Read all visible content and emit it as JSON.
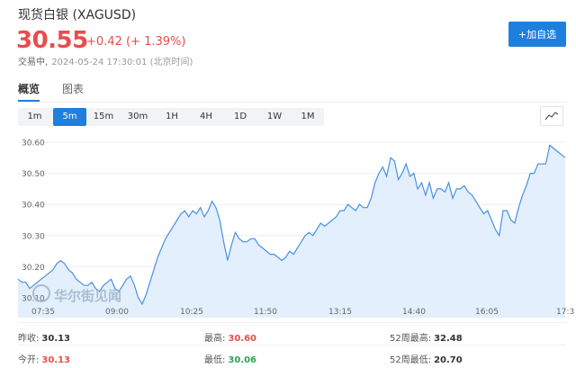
{
  "header": {
    "title": "现货白银 (XAGUSD)",
    "price": "30.55",
    "change": "+0.42 (+ 1.39%)",
    "status": "交易中,",
    "timestamp": "2024-05-24 17:30:01 (北京时间)",
    "watch_label": "+加自选"
  },
  "tabs": [
    {
      "label": "概览",
      "active": true
    },
    {
      "label": "图表",
      "active": false
    }
  ],
  "periods": [
    {
      "label": "1m",
      "active": false
    },
    {
      "label": "5m",
      "active": true
    },
    {
      "label": "15m",
      "active": false
    },
    {
      "label": "30m",
      "active": false
    },
    {
      "label": "1H",
      "active": false
    },
    {
      "label": "4H",
      "active": false
    },
    {
      "label": "1D",
      "active": false
    },
    {
      "label": "1W",
      "active": false
    },
    {
      "label": "1M",
      "active": false
    }
  ],
  "chart_data": {
    "type": "area",
    "title": "",
    "xlabel": "",
    "ylabel": "",
    "x_ticks": [
      "07:35",
      "09:00",
      "10:25",
      "11:50",
      "13:15",
      "14:40",
      "16:05",
      "17:3"
    ],
    "y_ticks": [
      "30.60",
      "30.50",
      "30.40",
      "30.30",
      "30.20",
      "30.10"
    ],
    "ylim": [
      30.1,
      30.6
    ],
    "x": [
      "07:35",
      "07:40",
      "07:45",
      "07:50",
      "07:55",
      "08:00",
      "08:05",
      "08:10",
      "08:15",
      "08:20",
      "08:25",
      "08:30",
      "08:35",
      "08:40",
      "08:45",
      "08:50",
      "08:55",
      "09:00",
      "09:05",
      "09:10",
      "09:15",
      "09:20",
      "09:25",
      "09:30",
      "09:35",
      "09:40",
      "09:45",
      "09:50",
      "09:55",
      "10:00",
      "10:05",
      "10:10",
      "10:15",
      "10:20",
      "10:25",
      "10:30",
      "10:35",
      "10:40",
      "10:45",
      "10:50",
      "10:55",
      "11:00",
      "11:05",
      "11:10",
      "11:15",
      "11:20",
      "11:25",
      "11:30",
      "11:35",
      "11:40",
      "11:45",
      "11:50",
      "11:55",
      "12:00",
      "12:05",
      "12:10",
      "12:15",
      "12:20",
      "12:25",
      "12:30",
      "12:35",
      "12:40",
      "12:45",
      "12:50",
      "12:55",
      "13:00",
      "13:05",
      "13:10",
      "13:15",
      "13:20",
      "13:25",
      "13:30",
      "13:35",
      "13:40",
      "13:45",
      "13:50",
      "13:55",
      "14:00",
      "14:05",
      "14:10",
      "14:15",
      "14:20",
      "14:25",
      "14:30",
      "14:35",
      "14:40",
      "14:45",
      "14:50",
      "14:55",
      "15:00",
      "15:05",
      "15:10",
      "15:15",
      "15:20",
      "15:25",
      "15:30",
      "15:35",
      "15:40",
      "15:45",
      "15:50",
      "15:55",
      "16:00",
      "16:05",
      "16:10",
      "16:15",
      "16:20",
      "16:25",
      "16:30",
      "16:35",
      "16:40",
      "16:45",
      "16:50",
      "16:55",
      "17:00",
      "17:05",
      "17:10",
      "17:15",
      "17:20",
      "17:25",
      "17:30"
    ],
    "values": [
      30.16,
      30.15,
      30.15,
      30.13,
      30.14,
      30.15,
      30.16,
      30.17,
      30.18,
      30.19,
      30.21,
      30.22,
      30.21,
      30.19,
      30.18,
      30.16,
      30.15,
      30.14,
      30.14,
      30.15,
      30.13,
      30.12,
      30.14,
      30.15,
      30.16,
      30.13,
      30.12,
      30.14,
      30.16,
      30.17,
      30.14,
      30.1,
      30.08,
      30.11,
      30.15,
      30.19,
      30.23,
      30.26,
      30.29,
      30.31,
      30.33,
      30.35,
      30.37,
      30.38,
      30.36,
      30.38,
      30.37,
      30.39,
      30.36,
      30.38,
      30.41,
      30.39,
      30.35,
      30.28,
      30.22,
      30.27,
      30.31,
      30.29,
      30.28,
      30.28,
      30.29,
      30.29,
      30.27,
      30.26,
      30.25,
      30.24,
      30.24,
      30.23,
      30.22,
      30.23,
      30.25,
      30.24,
      30.26,
      30.28,
      30.3,
      30.31,
      30.3,
      30.32,
      30.34,
      30.33,
      30.34,
      30.35,
      30.36,
      30.38,
      30.38,
      30.4,
      30.39,
      30.38,
      30.4,
      30.39,
      30.39,
      30.42,
      30.47,
      30.5,
      30.52,
      30.49,
      30.55,
      30.54,
      30.48,
      30.5,
      30.53,
      30.49,
      30.5,
      30.45,
      30.47,
      30.43,
      30.47,
      30.42,
      30.45,
      30.45,
      30.44,
      30.47,
      30.42,
      30.45,
      30.45,
      30.46,
      30.44,
      30.43,
      30.41,
      30.39,
      30.37,
      30.38,
      30.35,
      30.32,
      30.3,
      30.38,
      30.38,
      30.35,
      30.34,
      30.39,
      30.43,
      30.46,
      30.5,
      30.5,
      30.53,
      30.53,
      30.53,
      30.59,
      30.58,
      30.57,
      30.56,
      30.55
    ],
    "line_color": "#4a90e2",
    "fill_color": "#e3effc",
    "grid": true
  },
  "watermark": {
    "text": "华尔街见闻"
  },
  "stats": [
    [
      {
        "label": "昨收:",
        "value": "30.13",
        "color": "dark"
      },
      {
        "label": "最高:",
        "value": "30.60",
        "color": "red"
      },
      {
        "label": "52周最高:",
        "value": "32.48",
        "color": "dark"
      }
    ],
    [
      {
        "label": "今开:",
        "value": "30.13",
        "color": "red"
      },
      {
        "label": "最低:",
        "value": "30.06",
        "color": "green"
      },
      {
        "label": "52周最低:",
        "value": "20.70",
        "color": "dark"
      }
    ]
  ]
}
